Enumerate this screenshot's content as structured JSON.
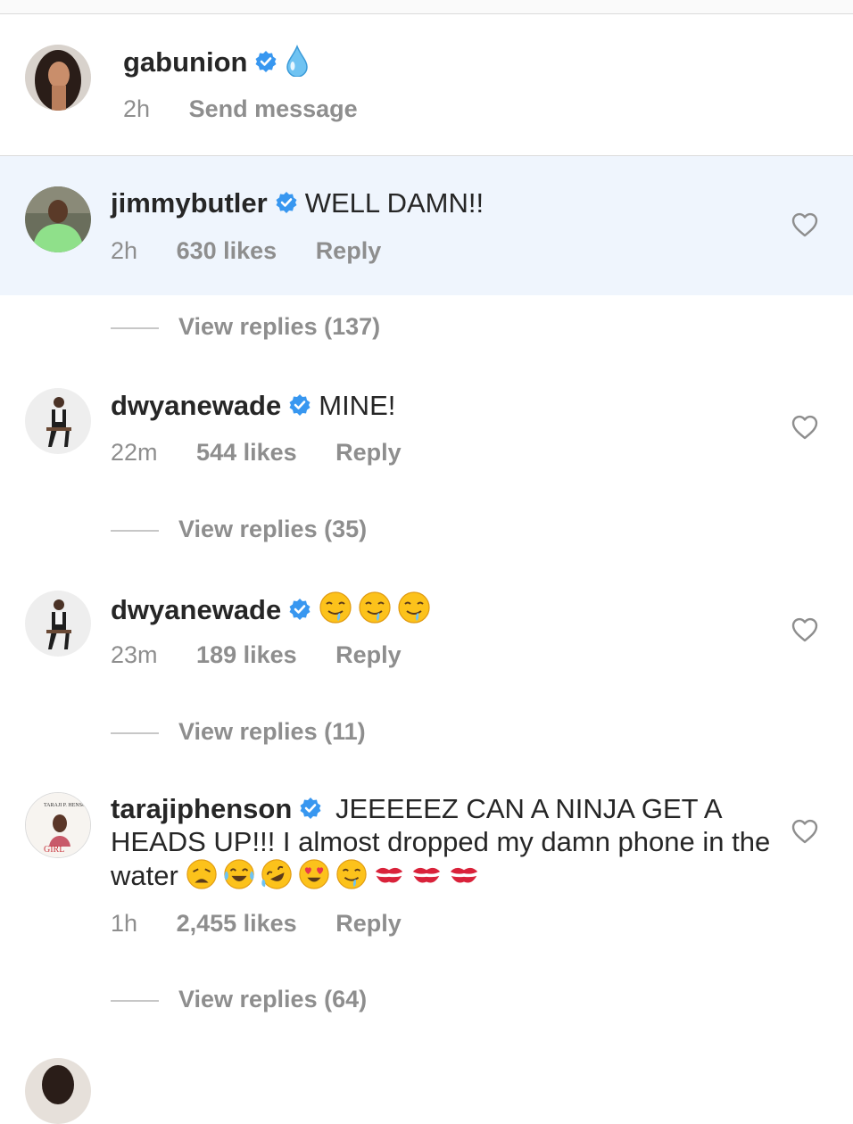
{
  "caption": {
    "username": "gabunion",
    "emoji": "droplet",
    "time": "2h",
    "send_message": "Send message"
  },
  "comments": [
    {
      "username": "jimmybutler",
      "text": "WELL DAMN!!",
      "time": "2h",
      "likes": "630 likes",
      "reply": "Reply",
      "view_replies": "View replies (137)",
      "highlighted": true
    },
    {
      "username": "dwyanewade",
      "text": "MINE!",
      "time": "22m",
      "likes": "544 likes",
      "reply": "Reply",
      "view_replies": "View replies (35)"
    },
    {
      "username": "dwyanewade",
      "text": "",
      "emojis": [
        "drooling-face",
        "drooling-face",
        "drooling-face"
      ],
      "time": "23m",
      "likes": "189 likes",
      "reply": "Reply",
      "view_replies": "View replies (11)"
    },
    {
      "username": "tarajiphenson",
      "text": "JEEEEEZ CAN A NINJA GET A HEADS UP!!! I almost dropped my damn phone in the water",
      "emojis": [
        "weary-face",
        "tears-of-joy-face",
        "rolling-laughing-face",
        "heart-eyes-face",
        "drooling-face",
        "kiss-mark",
        "kiss-mark",
        "kiss-mark"
      ],
      "time": "1h",
      "likes": "2,455 likes",
      "reply": "Reply",
      "view_replies": "View replies (64)"
    }
  ],
  "avatar_book_text": {
    "top": "TARAJI P. HENSON",
    "bottom": "GIRL"
  },
  "colors": {
    "verified": "#3897f0",
    "meta": "#8e8e8e",
    "highlight_bg": "#eff5fd"
  }
}
